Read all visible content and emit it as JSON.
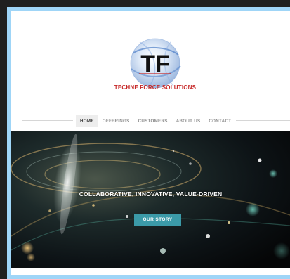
{
  "logo": {
    "initials": "TF",
    "company_name": "TECHNE FORCE SOLUTIONS",
    "brand_red": "#c62828",
    "globe_blue": "#4f7fc8"
  },
  "nav": {
    "items": [
      {
        "label": "HOME",
        "active": true
      },
      {
        "label": "OFFERINGS",
        "active": false
      },
      {
        "label": "CUSTOMERS",
        "active": false
      },
      {
        "label": "ABOUT US",
        "active": false
      },
      {
        "label": "CONTACT",
        "active": false
      }
    ]
  },
  "hero": {
    "headline": "COLLABORATIVE, INNOVATIVE, VALUE-DRIVEN",
    "button_label": "OUR STORY",
    "button_color": "#3b9aa8"
  },
  "colors": {
    "frame": "#9fd5f7",
    "background": "#1f1f1f",
    "page": "#ffffff"
  }
}
